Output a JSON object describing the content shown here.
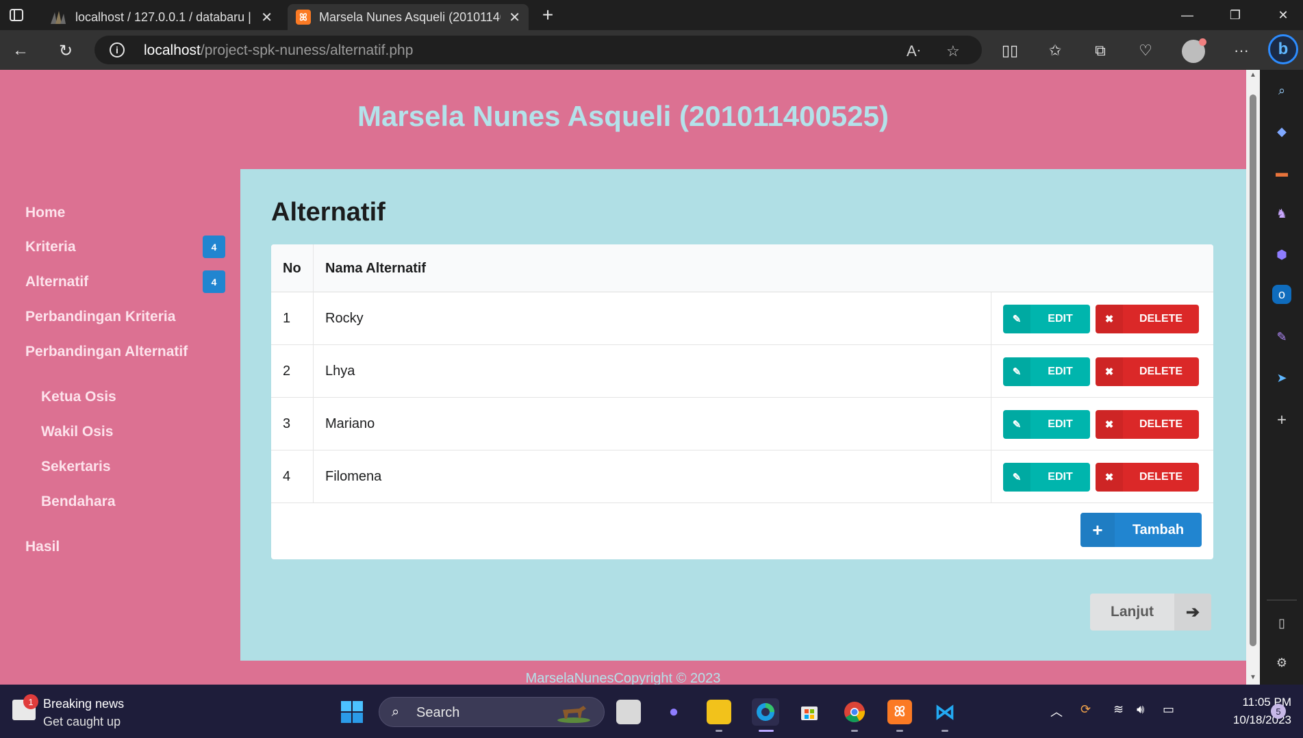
{
  "browser": {
    "tabs": [
      {
        "title": "localhost / 127.0.0.1 / databaru |",
        "active": false,
        "favicon": "phpmyadmin-icon"
      },
      {
        "title": "Marsela Nunes Asqueli (20101140",
        "active": true,
        "favicon": "xampp-icon"
      }
    ],
    "new_tab_symbol": "+",
    "address": {
      "host": "localhost",
      "path": "/project-spk-nuness/alternatif.php"
    },
    "avatar_notification_color": "#f08080"
  },
  "site": {
    "title": "Marsela Nunes Asqueli (201011400525)",
    "footer": "MarselaNunesCopyright © 2023",
    "colors": {
      "header_bg": "#dc7192",
      "content_bg": "#b0dfe5",
      "title_color": "#b3e2ea"
    }
  },
  "menu": {
    "home": "Home",
    "kriteria": {
      "label": "Kriteria",
      "count": "4"
    },
    "alternatif": {
      "label": "Alternatif",
      "count": "4"
    },
    "perbandingan_kriteria": "Perbandingan Kriteria",
    "perbandingan_alternatif": "Perbandingan Alternatif",
    "sub": [
      "Ketua Osis",
      "Wakil Osis",
      "Sekertaris",
      "Bendahara"
    ],
    "hasil": "Hasil"
  },
  "main": {
    "heading": "Alternatif",
    "table": {
      "headers": {
        "no": "No",
        "nama": "Nama Alternatif"
      },
      "rows": [
        {
          "no": "1",
          "nama": "Rocky"
        },
        {
          "no": "2",
          "nama": "Lhya"
        },
        {
          "no": "3",
          "nama": "Mariano"
        },
        {
          "no": "4",
          "nama": "Filomena"
        }
      ],
      "edit_label": "EDIT",
      "delete_label": "DELETE"
    },
    "add_label": "Tambah",
    "next_label": "Lanjut",
    "colors": {
      "edit": "#00b5ad",
      "delete": "#db2828",
      "add": "#2185d0"
    }
  },
  "taskbar": {
    "news_title": "Breaking news",
    "news_sub": "Get caught up",
    "news_badge": "1",
    "search_label": "Search",
    "time": "11:05 PM",
    "date": "10/18/2023",
    "notification_count": "5"
  }
}
